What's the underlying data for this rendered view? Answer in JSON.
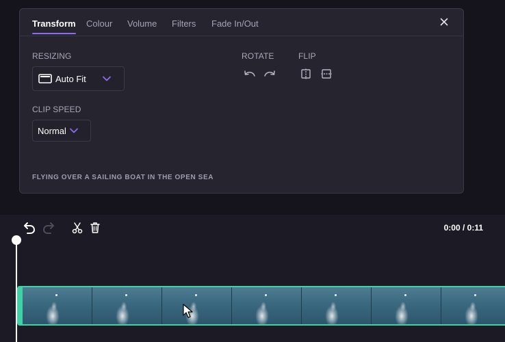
{
  "panel": {
    "tabs": [
      {
        "label": "Transform",
        "active": true
      },
      {
        "label": "Colour",
        "active": false
      },
      {
        "label": "Volume",
        "active": false
      },
      {
        "label": "Filters",
        "active": false
      },
      {
        "label": "Fade In/Out",
        "active": false
      }
    ],
    "close_icon": "close-icon",
    "resizing": {
      "label": "RESIZING",
      "value": "Auto Fit",
      "icon": "aspect-ratio-icon"
    },
    "rotate": {
      "label": "ROTATE",
      "icons": [
        "rotate-left-icon",
        "rotate-right-icon"
      ]
    },
    "flip": {
      "label": "FLIP",
      "icons": [
        "flip-horizontal-icon",
        "flip-vertical-icon"
      ]
    },
    "clip_speed": {
      "label": "CLIP SPEED",
      "value": "Normal"
    },
    "clip_title": "FLYING OVER A SAILING BOAT IN THE OPEN SEA"
  },
  "timeline": {
    "tools": [
      "undo-icon",
      "redo-icon",
      "split-icon",
      "delete-icon"
    ],
    "time_readout": "0:00 / 0:11",
    "frame_count": 7
  },
  "colors": {
    "accent": "#8d6cf2",
    "clip_border": "#3fd2a4",
    "background": "#15141d",
    "panel": "#25242f"
  }
}
